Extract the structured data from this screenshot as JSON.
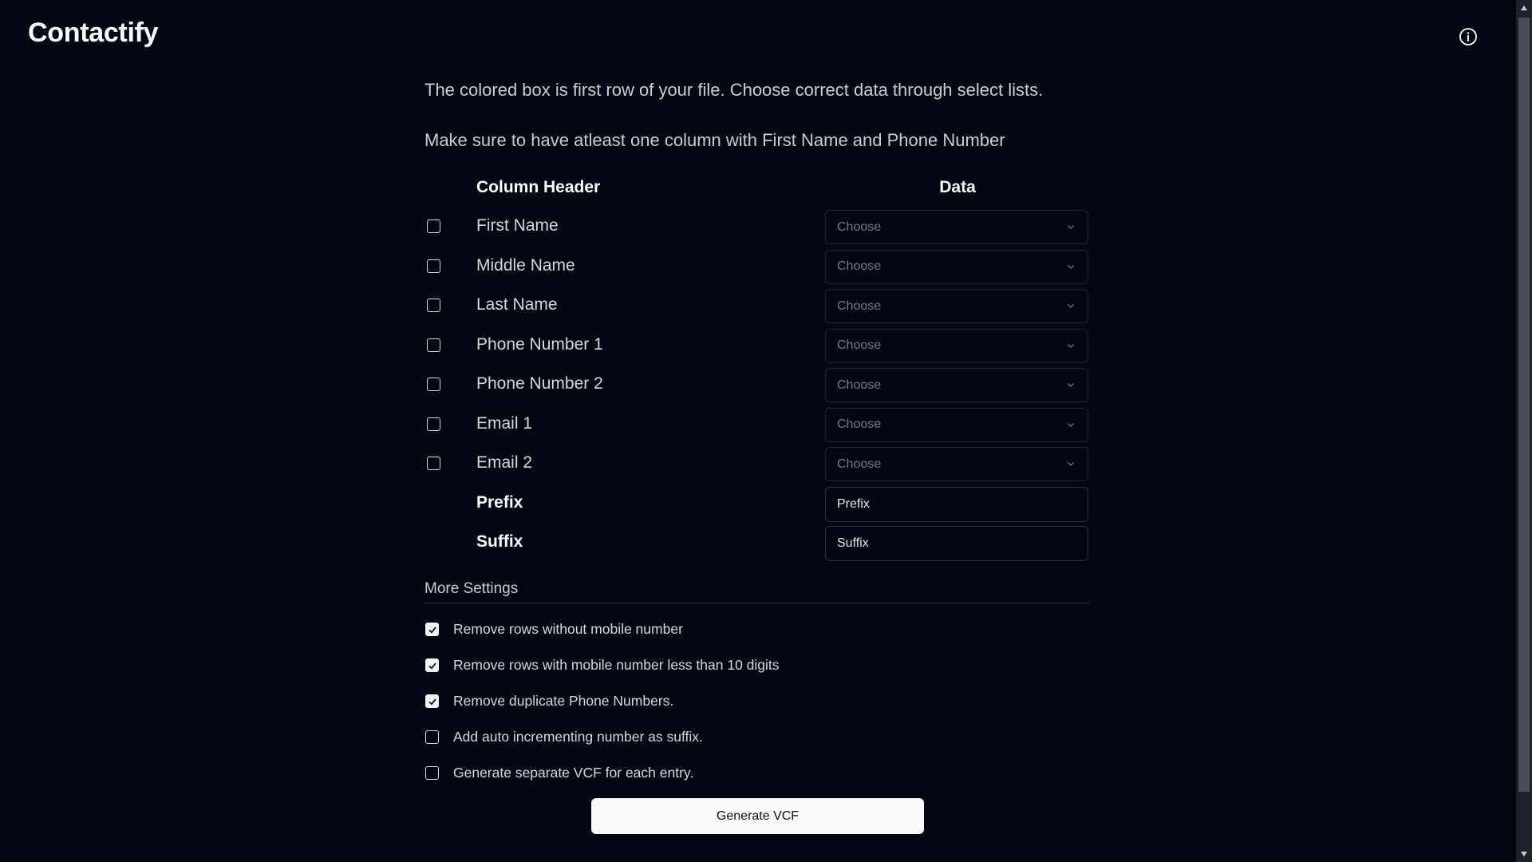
{
  "app": {
    "title": "Contactify",
    "info_icon": "info-icon"
  },
  "intro": {
    "line1": "The colored box is first row of your file. Choose correct data through select lists.",
    "line2": "Make sure to have atleast one column with First Name and Phone Number"
  },
  "mapping": {
    "column_header_title": "Column Header",
    "data_title": "Data",
    "fields": [
      {
        "label": "First Name",
        "checked": false,
        "select_value": "Choose"
      },
      {
        "label": "Middle Name",
        "checked": false,
        "select_value": "Choose"
      },
      {
        "label": "Last Name",
        "checked": false,
        "select_value": "Choose"
      },
      {
        "label": "Phone Number 1",
        "checked": false,
        "select_value": "Choose"
      },
      {
        "label": "Phone Number 2",
        "checked": false,
        "select_value": "Choose"
      },
      {
        "label": "Email 1",
        "checked": false,
        "select_value": "Choose"
      },
      {
        "label": "Email 2",
        "checked": false,
        "select_value": "Choose"
      }
    ],
    "prefix": {
      "label": "Prefix",
      "placeholder": "Prefix"
    },
    "suffix": {
      "label": "Suffix",
      "placeholder": "Suffix"
    }
  },
  "more_settings": {
    "title": "More Settings",
    "options": [
      {
        "label": "Remove rows without mobile number",
        "checked": true
      },
      {
        "label": "Remove rows with mobile number less than 10 digits",
        "checked": true
      },
      {
        "label": "Remove duplicate Phone Numbers.",
        "checked": true
      },
      {
        "label": "Add auto incrementing number as suffix.",
        "checked": false
      },
      {
        "label": "Generate separate VCF for each entry.",
        "checked": false
      }
    ]
  },
  "actions": {
    "generate_label": "Generate VCF"
  },
  "colors": {
    "background": "#020711",
    "button_bg": "#fafafa",
    "text_muted": "#c9ccd1"
  }
}
